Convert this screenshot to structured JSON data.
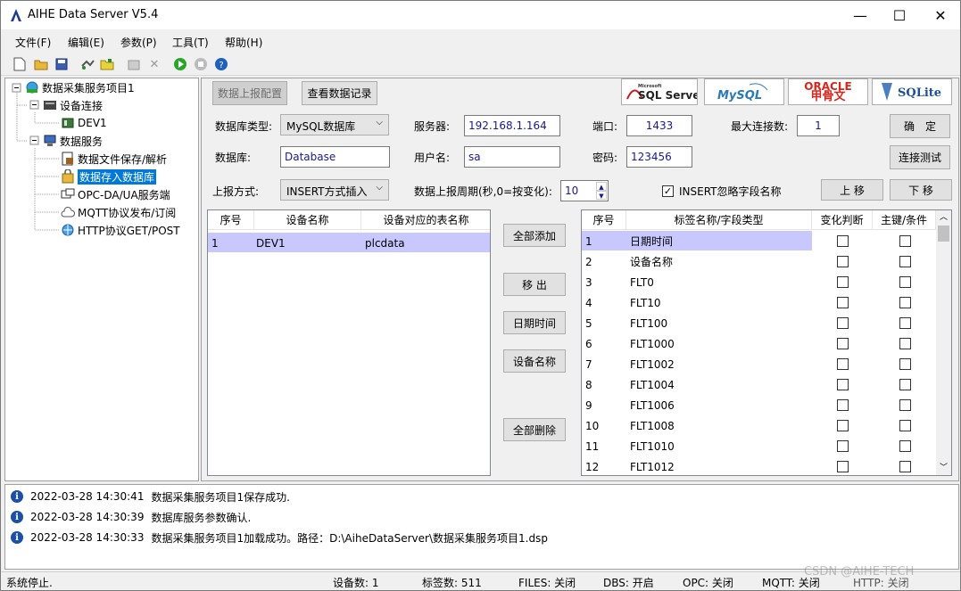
{
  "window": {
    "title": "AIHE Data Server V5.4",
    "minimize": "—",
    "maximize": "☐",
    "close": "✕"
  },
  "menu": [
    "文件(F)",
    "编辑(E)",
    "参数(P)",
    "工具(T)",
    "帮助(H)"
  ],
  "tree": {
    "root": "数据采集服务项目1",
    "device_conn": "设备连接",
    "dev1": "DEV1",
    "data_service": "数据服务",
    "items": [
      "数据文件保存/解析",
      "数据存入数据库",
      "OPC-DA/UA服务端",
      "MQTT协议发布/订阅",
      "HTTP协议GET/POST"
    ]
  },
  "tabs": {
    "upload_config": "数据上报配置",
    "view_records": "查看数据记录"
  },
  "db_logos": {
    "sqlserver": "SQL Server",
    "sqlserver_small": "Microsoft",
    "mysql": "MySQL",
    "oracle": "ORACLE",
    "oracle_cn": "甲骨文",
    "sqlite": "SQLite"
  },
  "form": {
    "db_type_label": "数据库类型:",
    "db_type_value": "MySQL数据库",
    "server_label": "服务器:",
    "server_value": "192.168.1.164",
    "port_label": "端口:",
    "port_value": "1433",
    "maxconn_label": "最大连接数:",
    "maxconn_value": "1",
    "confirm": "确　定",
    "database_label": "数据库:",
    "database_value": "Database",
    "user_label": "用户名:",
    "user_value": "sa",
    "pwd_label": "密码:",
    "pwd_value": "123456",
    "test_conn": "连接测试",
    "report_label": "上报方式:",
    "report_value": "INSERT方式插入",
    "period_label": "数据上报周期(秒,0=按变化):",
    "period_value": "10",
    "ignore_field": "INSERT忽略字段名称",
    "move_up": "上 移",
    "move_down": "下 移"
  },
  "left_table": {
    "headers": [
      "序号",
      "设备名称",
      "设备对应的表名称"
    ],
    "rows": [
      [
        "1",
        "DEV1",
        "plcdata"
      ]
    ]
  },
  "mid_buttons": {
    "add_all": "全部添加",
    "remove": "移 出",
    "datetime": "日期时间",
    "devname": "设备名称",
    "delete_all": "全部删除"
  },
  "right_table": {
    "headers": [
      "序号",
      "标签名称/字段类型",
      "变化判断",
      "主键/条件"
    ],
    "rows": [
      [
        "1",
        "日期时间"
      ],
      [
        "2",
        "设备名称"
      ],
      [
        "3",
        "FLT0"
      ],
      [
        "4",
        "FLT10"
      ],
      [
        "5",
        "FLT100"
      ],
      [
        "6",
        "FLT1000"
      ],
      [
        "7",
        "FLT1002"
      ],
      [
        "8",
        "FLT1004"
      ],
      [
        "9",
        "FLT1006"
      ],
      [
        "10",
        "FLT1008"
      ],
      [
        "11",
        "FLT1010"
      ],
      [
        "12",
        "FLT1012"
      ]
    ]
  },
  "log": [
    {
      "time": "2022-03-28 14:30:41",
      "msg": "数据采集服务项目1保存成功."
    },
    {
      "time": "2022-03-28 14:30:39",
      "msg": "数据库服务参数确认."
    },
    {
      "time": "2022-03-28 14:30:33",
      "msg": "数据采集服务项目1加载成功。路径：D:\\AiheDataServer\\数据采集服务项目1.dsp"
    }
  ],
  "status": {
    "state": "系统停止.",
    "devices": "设备数:  1",
    "tags": "标签数:  511",
    "files": "FILES:  关闭",
    "dbs": "DBS:  开启",
    "opc": "OPC:  关闭",
    "mqtt": "MQTT:  关闭",
    "http": "HTTP:  关闭",
    "watermark": "CSDN @AIHE-TECH"
  },
  "colors": {
    "selection": "#0078d7",
    "row_highlight": "#c8c8ff"
  }
}
